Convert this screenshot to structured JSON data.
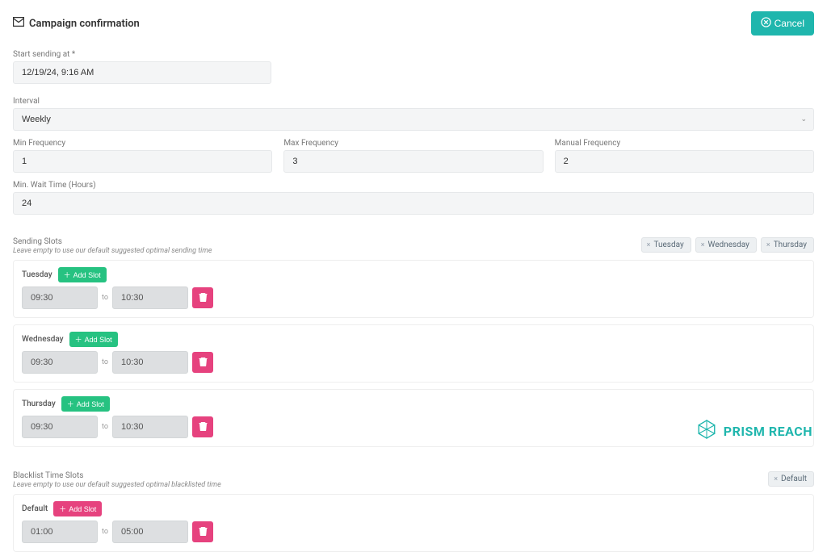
{
  "header": {
    "title": "Campaign confirmation",
    "cancel_label": "Cancel"
  },
  "fields": {
    "start_label": "Start sending at *",
    "start_value": "12/19/24, 9:16 AM",
    "interval_label": "Interval",
    "interval_value": "Weekly",
    "min_freq_label": "Min Frequency",
    "min_freq_value": "1",
    "max_freq_label": "Max Frequency",
    "max_freq_value": "3",
    "manual_freq_label": "Manual Frequency",
    "manual_freq_value": "2",
    "min_wait_label": "Min. Wait Time (Hours)",
    "min_wait_value": "24"
  },
  "sending_slots": {
    "label": "Sending Slots",
    "hint": "Leave empty to use our default suggested optimal sending time",
    "chips": [
      "Tuesday",
      "Wednesday",
      "Thursday"
    ],
    "add_slot_label": "Add Slot",
    "to_label": "to",
    "days": [
      {
        "name": "Tuesday",
        "from": "09:30",
        "to": "10:30"
      },
      {
        "name": "Wednesday",
        "from": "09:30",
        "to": "10:30"
      },
      {
        "name": "Thursday",
        "from": "09:30",
        "to": "10:30"
      }
    ]
  },
  "blacklist": {
    "label": "Blacklist Time Slots",
    "hint": "Leave empty to use our default suggested optimal blacklisted time",
    "chips": [
      "Default"
    ],
    "add_slot_label": "Add Slot",
    "to_label": "to",
    "days": [
      {
        "name": "Default",
        "from": "01:00",
        "to": "05:00"
      }
    ]
  },
  "brand": "PRISM REACH"
}
